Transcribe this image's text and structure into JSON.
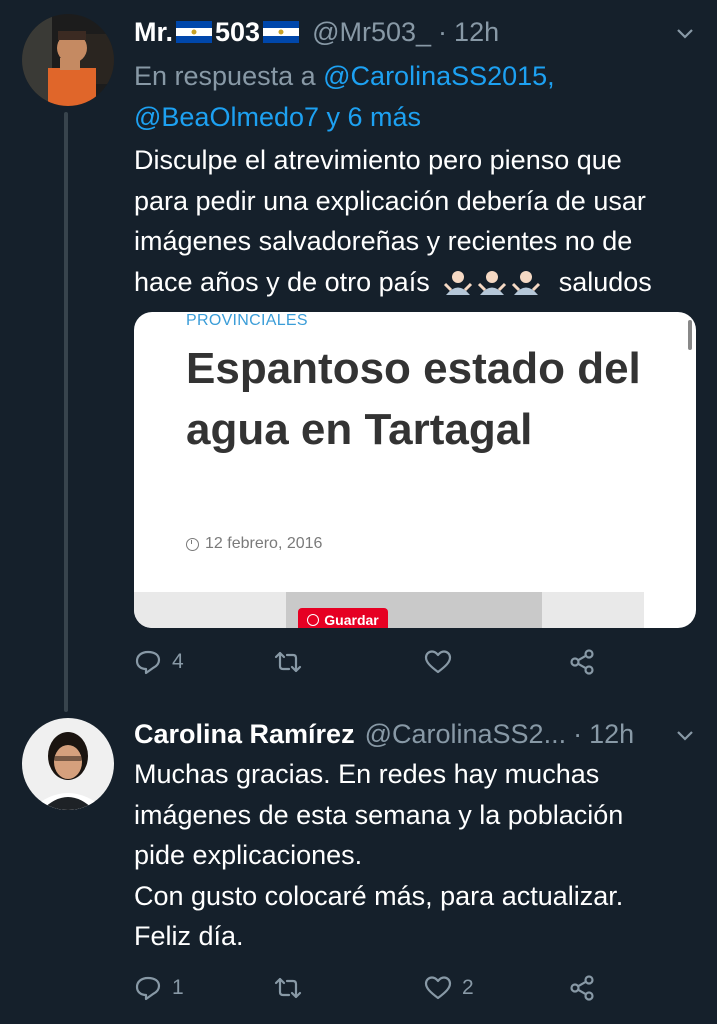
{
  "tweets": [
    {
      "display_name": "Mr.",
      "name_suffix": "503",
      "handle": "@Mr503_",
      "dot": "·",
      "time": "12h",
      "reply_prefix": "En respuesta a",
      "reply_mention_1": "@CarolinaSS2015,",
      "reply_mention_2": "@BeaOlmedo7 y 6 más",
      "text_lines": [
        "Disculpe el atrevimiento pero pienso que",
        "para pedir una explicación debería de usar",
        "imágenes salvadoreñas y recientes no de",
        "hace años y de otro país"
      ],
      "text_tail": "saludos",
      "card": {
        "section": "PROVINCIALES",
        "headline": "Espantoso estado del agua en Tartagal",
        "date": "12 febrero, 2016",
        "save_label": "Guardar"
      },
      "reply_count": "4",
      "retweet_count": "",
      "like_count": ""
    },
    {
      "display_name": "Carolina Ramírez",
      "handle": "@CarolinaSS2...",
      "dot": "·",
      "time": "12h",
      "text_lines": [
        "Muchas gracias. En redes hay muchas",
        "imágenes de esta semana y la población",
        "pide explicaciones.",
        "Con gusto colocaré más, para actualizar.",
        "Feliz día."
      ],
      "reply_count": "1",
      "retweet_count": "",
      "like_count": "2"
    }
  ],
  "colors": {
    "background": "#15202b",
    "secondary_text": "#8899a6",
    "link": "#1da1f2",
    "thread_line": "#38444d"
  },
  "icons": [
    "chevron-down-icon",
    "reply-icon",
    "retweet-icon",
    "like-icon",
    "share-icon",
    "el-salvador-flag-icon",
    "person-shrugging-emoji",
    "clock-icon",
    "pinterest-icon"
  ]
}
